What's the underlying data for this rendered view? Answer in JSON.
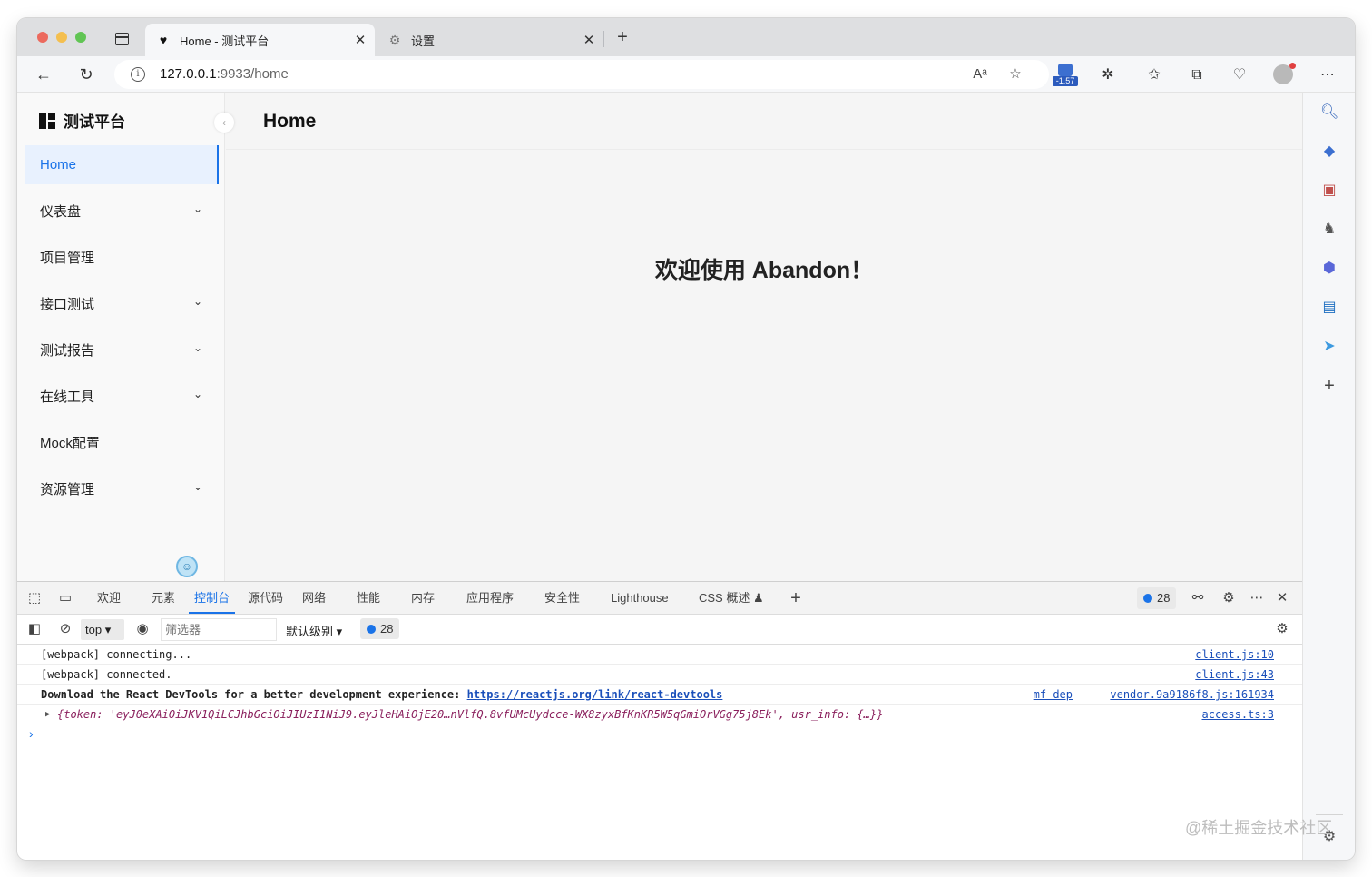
{
  "browser": {
    "tabs": [
      {
        "title": "Home - 测试平台",
        "favicon": "heart-icon",
        "active": true
      },
      {
        "title": "设置",
        "favicon": "gear-icon",
        "active": false
      }
    ],
    "address": {
      "host": "127.0.0.1",
      "path": ":9933/home"
    },
    "extension_badge": "-1.57"
  },
  "app": {
    "name": "测试平台",
    "page_title": "Home",
    "welcome": "欢迎使用 Abandon！",
    "menu": [
      {
        "label": "Home",
        "has_children": false,
        "active": true
      },
      {
        "label": "仪表盘",
        "has_children": true,
        "active": false
      },
      {
        "label": "项目管理",
        "has_children": false,
        "active": false
      },
      {
        "label": "接口测试",
        "has_children": true,
        "active": false
      },
      {
        "label": "测试报告",
        "has_children": true,
        "active": false
      },
      {
        "label": "在线工具",
        "has_children": true,
        "active": false
      },
      {
        "label": "Mock配置",
        "has_children": false,
        "active": false
      },
      {
        "label": "资源管理",
        "has_children": true,
        "active": false
      }
    ]
  },
  "devtools": {
    "tabs": [
      "欢迎",
      "元素",
      "控制台",
      "源代码",
      "网络",
      "性能",
      "内存",
      "应用程序",
      "安全性",
      "Lighthouse",
      "CSS 概述 ♟"
    ],
    "active_tab": "控制台",
    "issues_count": "28",
    "context": "top",
    "filter_placeholder": "筛选器",
    "levels": "默认级别",
    "messages_count": "28",
    "logs": [
      {
        "text": "[webpack] connecting...",
        "source": "client.js:10"
      },
      {
        "text": "[webpack] connected.",
        "source": "client.js:43"
      },
      {
        "text": "Download the React DevTools for a better development experience: ",
        "link": "https://reactjs.org/link/react-devtools",
        "source_a": "mf-dep",
        "source": "vendor.9a9186f8.js:161934"
      },
      {
        "text": "{token: 'eyJ0eXAiOiJKV1QiLCJhbGciOiJIUzI1NiJ9.eyJleHAiOjE20…nVlfQ.8vfUMcUydcce-WX8zyxBfKnKR5W5qGmiOrVGg75j8Ek', usr_info: {…}}",
        "source": "access.ts:3"
      }
    ]
  },
  "watermark": "@稀土掘金技术社区",
  "colors": {
    "accent": "#1a73e8",
    "active_menu_bg": "#e8f1fe"
  }
}
